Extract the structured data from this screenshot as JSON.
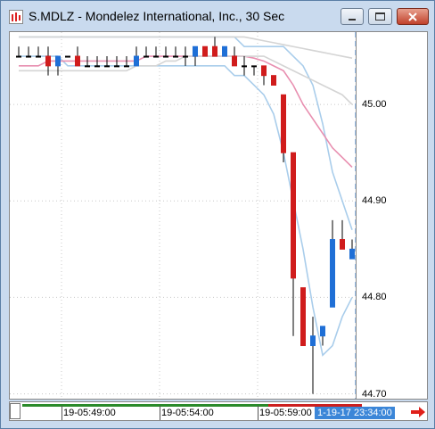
{
  "window": {
    "title": "S.MDLZ - Mondelez International, Inc., 30 Sec"
  },
  "icons": {
    "app": "chart-app-icon",
    "minimize": "minimize-icon",
    "maximize": "maximize-icon",
    "close": "close-icon",
    "scroll": "arrow-right-icon"
  },
  "colors": {
    "up_candle": "#1f6fd6",
    "down_candle": "#d01c1c",
    "band": "#a9cdeb",
    "ma_pink": "#e88fb0",
    "ma_gray": "#cfcfcf",
    "cursor_line": "#3b86d8"
  },
  "x_axis": {
    "labels": [
      "19-05:49:00",
      "19-05:54:00",
      "19-05:59:00"
    ]
  },
  "cursor": {
    "label": "1-19-17 23:34:00"
  },
  "chart_data": {
    "type": "candlestick",
    "title": "S.MDLZ - Mondelez International, Inc., 30 Sec",
    "ylim": [
      44.695,
      45.075
    ],
    "y_ticks": [
      45.0,
      44.9,
      44.8,
      44.7
    ],
    "y_tick_labels": [
      "45.00",
      "44.90",
      "44.80",
      "44.70"
    ],
    "grid": true,
    "candles": [
      {
        "o": 45.05,
        "h": 45.06,
        "l": 45.05,
        "c": 45.05
      },
      {
        "o": 45.05,
        "h": 45.06,
        "l": 45.05,
        "c": 45.05
      },
      {
        "o": 45.05,
        "h": 45.06,
        "l": 45.05,
        "c": 45.05
      },
      {
        "o": 45.05,
        "h": 45.06,
        "l": 45.03,
        "c": 45.04
      },
      {
        "o": 45.04,
        "h": 45.05,
        "l": 45.03,
        "c": 45.05
      },
      {
        "o": 45.05,
        "h": 45.05,
        "l": 45.05,
        "c": 45.05
      },
      {
        "o": 45.05,
        "h": 45.06,
        "l": 45.04,
        "c": 45.04
      },
      {
        "o": 45.04,
        "h": 45.05,
        "l": 45.04,
        "c": 45.04
      },
      {
        "o": 45.04,
        "h": 45.05,
        "l": 45.04,
        "c": 45.04
      },
      {
        "o": 45.04,
        "h": 45.05,
        "l": 45.04,
        "c": 45.04
      },
      {
        "o": 45.04,
        "h": 45.05,
        "l": 45.04,
        "c": 45.04
      },
      {
        "o": 45.04,
        "h": 45.05,
        "l": 45.04,
        "c": 45.04
      },
      {
        "o": 45.04,
        "h": 45.06,
        "l": 45.04,
        "c": 45.05
      },
      {
        "o": 45.05,
        "h": 45.06,
        "l": 45.05,
        "c": 45.05
      },
      {
        "o": 45.05,
        "h": 45.06,
        "l": 45.05,
        "c": 45.05
      },
      {
        "o": 45.05,
        "h": 45.06,
        "l": 45.05,
        "c": 45.05
      },
      {
        "o": 45.05,
        "h": 45.06,
        "l": 45.05,
        "c": 45.05
      },
      {
        "o": 45.05,
        "h": 45.06,
        "l": 45.04,
        "c": 45.05
      },
      {
        "o": 45.05,
        "h": 45.06,
        "l": 45.04,
        "c": 45.06
      },
      {
        "o": 45.06,
        "h": 45.06,
        "l": 45.05,
        "c": 45.05
      },
      {
        "o": 45.06,
        "h": 45.07,
        "l": 45.05,
        "c": 45.05
      },
      {
        "o": 45.05,
        "h": 45.06,
        "l": 45.05,
        "c": 45.06
      },
      {
        "o": 45.05,
        "h": 45.06,
        "l": 45.04,
        "c": 45.04
      },
      {
        "o": 45.04,
        "h": 45.05,
        "l": 45.03,
        "c": 45.04
      },
      {
        "o": 45.04,
        "h": 45.04,
        "l": 45.03,
        "c": 45.04
      },
      {
        "o": 45.04,
        "h": 45.04,
        "l": 45.02,
        "c": 45.03
      },
      {
        "o": 45.03,
        "h": 45.03,
        "l": 45.02,
        "c": 45.02
      },
      {
        "o": 45.01,
        "h": 45.01,
        "l": 44.94,
        "c": 44.95
      },
      {
        "o": 44.95,
        "h": 44.95,
        "l": 44.76,
        "c": 44.82
      },
      {
        "o": 44.81,
        "h": 44.81,
        "l": 44.75,
        "c": 44.75
      },
      {
        "o": 44.75,
        "h": 44.78,
        "l": 44.7,
        "c": 44.76
      },
      {
        "o": 44.76,
        "h": 44.77,
        "l": 44.75,
        "c": 44.77
      },
      {
        "o": 44.79,
        "h": 44.88,
        "l": 44.79,
        "c": 44.86
      },
      {
        "o": 44.86,
        "h": 44.88,
        "l": 44.85,
        "c": 44.85
      },
      {
        "o": 44.84,
        "h": 44.86,
        "l": 44.84,
        "c": 44.85
      }
    ],
    "overlays": [
      {
        "name": "band-upper",
        "color": "#a9cdeb",
        "values": [
          45.07,
          45.07,
          45.07,
          45.07,
          45.07,
          45.07,
          45.07,
          45.07,
          45.07,
          45.07,
          45.07,
          45.07,
          45.07,
          45.07,
          45.07,
          45.07,
          45.07,
          45.07,
          45.07,
          45.07,
          45.07,
          45.07,
          45.07,
          45.06,
          45.06,
          45.06,
          45.06,
          45.06,
          45.05,
          45.04,
          45.02,
          44.98,
          44.93,
          44.9,
          44.87
        ]
      },
      {
        "name": "band-lower",
        "color": "#a9cdeb",
        "values": [
          45.05,
          45.05,
          45.05,
          45.05,
          45.05,
          45.04,
          45.04,
          45.04,
          45.04,
          45.04,
          45.04,
          45.04,
          45.04,
          45.04,
          45.04,
          45.04,
          45.04,
          45.04,
          45.04,
          45.04,
          45.04,
          45.04,
          45.03,
          45.03,
          45.02,
          45.01,
          44.99,
          44.95,
          44.9,
          44.85,
          44.79,
          44.74,
          44.75,
          44.78,
          44.8
        ]
      },
      {
        "name": "ma-pink",
        "color": "#e88fb0",
        "values": [
          45.04,
          45.04,
          45.04,
          45.045,
          45.045,
          45.045,
          45.045,
          45.045,
          45.045,
          45.045,
          45.045,
          45.045,
          45.045,
          45.05,
          45.05,
          45.05,
          45.05,
          45.05,
          45.05,
          45.05,
          45.05,
          45.05,
          45.05,
          45.05,
          45.048,
          45.045,
          45.04,
          45.035,
          45.02,
          45.0,
          44.985,
          44.97,
          44.955,
          44.945,
          44.935
        ]
      },
      {
        "name": "ma-gray-a",
        "color": "#d4d4d4",
        "values": [
          45.035,
          45.035,
          45.035,
          45.035,
          45.035,
          45.035,
          45.035,
          45.035,
          45.035,
          45.035,
          45.035,
          45.035,
          45.04,
          45.04,
          45.04,
          45.045,
          45.045,
          45.05,
          45.05,
          45.05,
          45.05,
          45.05,
          45.05,
          45.05,
          45.05,
          45.05,
          45.045,
          45.04,
          45.035,
          45.03,
          45.025,
          45.02,
          45.015,
          45.01,
          45.0
        ]
      },
      {
        "name": "ma-gray-b",
        "color": "#d4d4d4",
        "values": [
          45.07,
          45.07,
          45.07,
          45.07,
          45.07,
          45.07,
          45.07,
          45.07,
          45.07,
          45.07,
          45.07,
          45.07,
          45.07,
          45.07,
          45.07,
          45.07,
          45.07,
          45.07,
          45.07,
          45.07,
          45.07,
          45.07,
          45.07,
          45.07,
          45.068,
          45.066,
          45.064,
          45.062,
          45.06,
          45.058,
          45.056,
          45.054,
          45.052,
          45.05,
          45.048
        ]
      }
    ]
  }
}
